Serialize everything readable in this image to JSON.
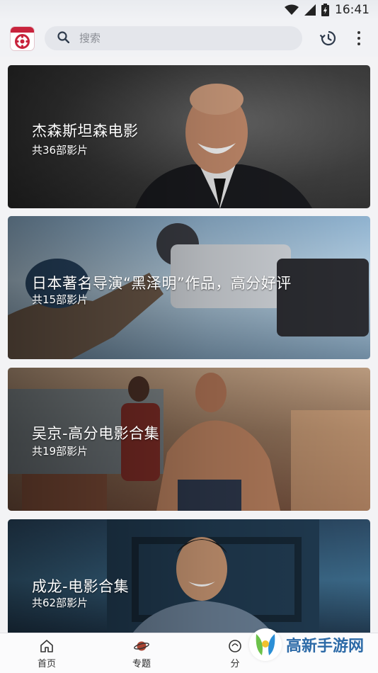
{
  "status_bar": {
    "time": "16:41",
    "icons": [
      "wifi-icon",
      "signal-icon",
      "battery-icon"
    ]
  },
  "top_bar": {
    "logo_icon": "movie-reel-logo",
    "search_placeholder": "搜索",
    "history_icon": "history-icon",
    "more_icon": "more-vert-icon"
  },
  "cards": [
    {
      "title": "杰森斯坦森电影",
      "count": "共36部影片"
    },
    {
      "title": "日本著名导演“黑泽明”作品，高分好评",
      "count": "共15部影片"
    },
    {
      "title": "吴京-高分电影合集",
      "count": "共19部影片"
    },
    {
      "title": "成龙-电影合集",
      "count": "共62部影片"
    }
  ],
  "bottom_nav": {
    "items": [
      {
        "label": "首页",
        "icon": "home-icon"
      },
      {
        "label": "专题",
        "icon": "planet-icon",
        "active": true
      },
      {
        "label": "分",
        "icon": "category-icon"
      }
    ]
  },
  "watermark": {
    "text": "高新手游网"
  },
  "colors": {
    "accent": "#c8233c",
    "watermark": "#2c6aa7"
  }
}
